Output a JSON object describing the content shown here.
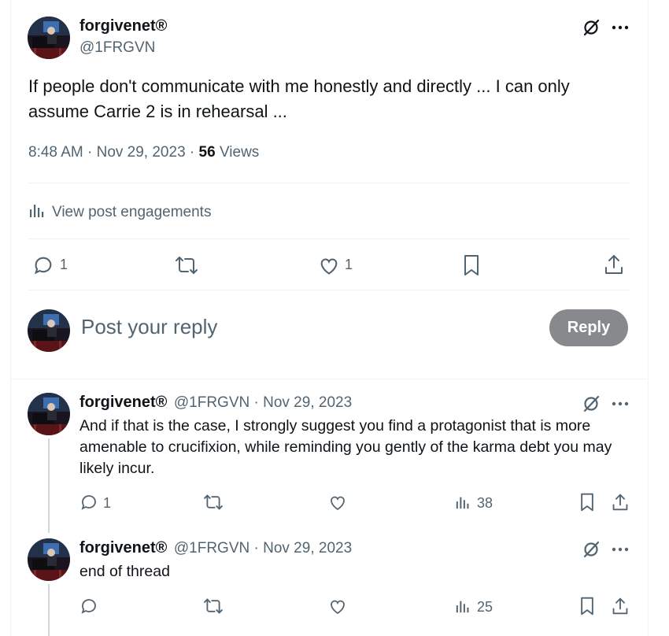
{
  "main_post": {
    "display_name": "forgivenet®",
    "handle": "@1FRGVN",
    "text": "If people don't communicate with me honestly and directly ... I can only assume Carrie 2 is in rehearsal ...",
    "time": "8:48 AM",
    "date": "Nov 29, 2023",
    "views_count": "56",
    "views_label": "Views",
    "engagements_label": "View post engagements",
    "replies": "1",
    "likes": "1"
  },
  "composer": {
    "placeholder": "Post your reply",
    "button_label": "Reply"
  },
  "replies": [
    {
      "display_name": "forgivenet®",
      "meta": "@1FRGVN · Nov 29, 2023",
      "text": "And if that is the case, I strongly suggest you find a protagonist that is more amenable to crucifixion, while reminding you gently of the karma debt you may likely incur.",
      "replies": "1",
      "views": "38"
    },
    {
      "display_name": "forgivenet®",
      "meta": "@1FRGVN · Nov 29, 2023",
      "text": "end of thread",
      "views": "25"
    }
  ],
  "colors": {
    "text": "#0f1419",
    "muted": "#536471",
    "divider": "#eff3f4",
    "reply_button": "#87898c"
  }
}
